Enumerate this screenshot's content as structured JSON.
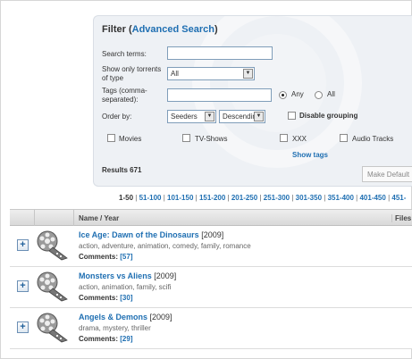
{
  "filter": {
    "title": "Filter",
    "advanced_link": "Advanced Search",
    "search_label": "Search terms:",
    "search_value": "",
    "type_label": "Show only torrents of type",
    "type_value": "All",
    "tags_label": "Tags (comma-separated):",
    "tags_value": "",
    "tags_mode_any": "Any",
    "tags_mode_all": "All",
    "order_label": "Order by:",
    "order_field": "Seeders",
    "order_direction": "Descending",
    "disable_grouping": "Disable grouping",
    "categories": [
      "Movies",
      "TV-Shows",
      "XXX",
      "Audio Tracks"
    ],
    "show_tags": "Show tags",
    "results": "Results 671",
    "make_default": "Make Default"
  },
  "pagination": {
    "current": "1-50",
    "pages": [
      "51-100",
      "101-150",
      "151-200",
      "201-250",
      "251-300",
      "301-350",
      "351-400",
      "401-450",
      "451-"
    ]
  },
  "table": {
    "name_header": "Name / Year",
    "files_header": "Files",
    "rows": [
      {
        "title": "Ice Age: Dawn of the Dinosaurs",
        "year": "[2009]",
        "genres": "action, adventure, animation, comedy, family, romance",
        "comments_label": "Comments:",
        "comments": "[57]"
      },
      {
        "title": "Monsters vs Aliens",
        "year": "[2009]",
        "genres": "action, animation, family, scifi",
        "comments_label": "Comments:",
        "comments": "[30]"
      },
      {
        "title": "Angels & Demons",
        "year": "[2009]",
        "genres": "drama, mystery, thriller",
        "comments_label": "Comments:",
        "comments": "[29]"
      }
    ]
  },
  "icons": {
    "expand": "plus-icon",
    "thumbnail": "film-reel-icon",
    "select_arrow": "chevron-down-icon"
  },
  "colors": {
    "link": "#1f6fb2",
    "panel_bg": "#eef1f5"
  }
}
